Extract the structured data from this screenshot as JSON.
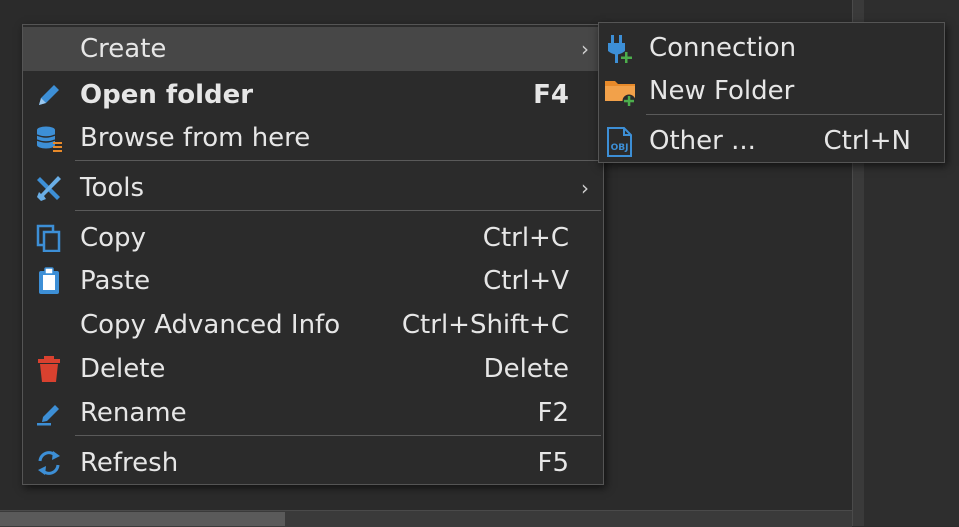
{
  "menu": {
    "items": [
      {
        "label": "Create",
        "icon": "none",
        "submenu": true
      },
      {
        "label": "Open folder",
        "shortcut": "F4",
        "icon": "pencil-icon",
        "bold": true
      },
      {
        "label": "Browse from here",
        "icon": "database-icon"
      },
      {
        "label": "Tools",
        "icon": "tools-icon",
        "submenu": true
      },
      {
        "label": "Copy",
        "shortcut": "Ctrl+C",
        "icon": "copy-icon"
      },
      {
        "label": "Paste",
        "shortcut": "Ctrl+V",
        "icon": "paste-icon"
      },
      {
        "label": "Copy Advanced Info",
        "shortcut": "Ctrl+Shift+C",
        "icon": "none"
      },
      {
        "label": "Delete",
        "shortcut": "Delete",
        "icon": "trash-icon"
      },
      {
        "label": "Rename",
        "shortcut": "F2",
        "icon": "rename-icon"
      },
      {
        "label": "Refresh",
        "shortcut": "F5",
        "icon": "refresh-icon"
      }
    ],
    "submenu_arrow": "›"
  },
  "submenu": {
    "items": [
      {
        "label": "Connection",
        "icon": "plug-add-icon"
      },
      {
        "label": "New Folder",
        "icon": "folder-add-icon"
      },
      {
        "label": "Other ...",
        "shortcut": "Ctrl+N",
        "icon": "obj-icon"
      }
    ],
    "obj_icon_text": "OBJ"
  },
  "colors": {
    "background": "#2b2b2b",
    "hover": "#474747",
    "text": "#e6e6e6",
    "accent_blue": "#3d8fd6",
    "delete_red": "#d9412f",
    "folder_orange": "#e88a2a",
    "add_green": "#4cae4c"
  }
}
